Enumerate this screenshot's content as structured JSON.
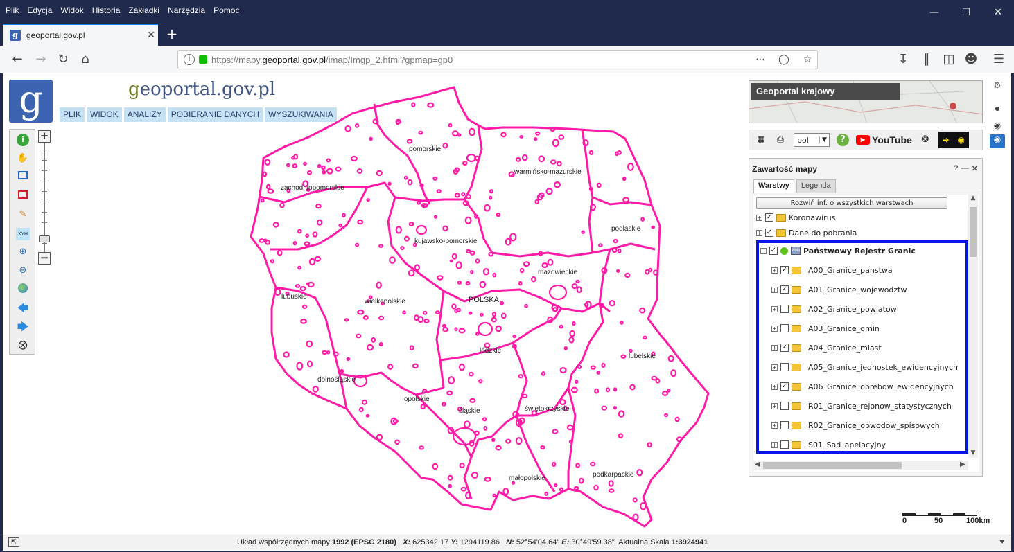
{
  "browser": {
    "menu": [
      "Plik",
      "Edycja",
      "Widok",
      "Historia",
      "Zakładki",
      "Narzędzia",
      "Pomoc"
    ],
    "tab_title": "geoportal.gov.pl",
    "url_prefix": "https://mapy.",
    "url_domain": "geoportal.gov.pl",
    "url_path": "/imap/Imgp_2.html?gpmap=gp0"
  },
  "site": {
    "logo_letter": "g",
    "title_g": "g",
    "title_rest": "eoportal.gov.pl",
    "menu": [
      "PLIK",
      "WIDOK",
      "ANALIZY",
      "POBIERANIE DANYCH",
      "WYSZUKIWANIA"
    ]
  },
  "map": {
    "country_label": "POLSKA",
    "border_color": "#ff1aa8",
    "voivodeships": [
      "pomorskie",
      "warmińsko-mazurskie",
      "zachodniopomorskie",
      "podlaskie",
      "kujawsko-pomorskie",
      "mazowieckie",
      "lubuskie",
      "wielkopolskie",
      "łódzkie",
      "lubelskie",
      "dolnośląskie",
      "opolskie",
      "śląskie",
      "świętokrzyskie",
      "małopolskie",
      "podkarpackie"
    ]
  },
  "right_panel": {
    "mini_map_title": "Geoportal krajowy",
    "language": "pol",
    "youtube_label": "YouTube",
    "panel_title": "Zawartość mapy",
    "tabs": [
      "Warstwy",
      "Legenda"
    ],
    "expand_button": "Rozwiń inf. o wszystkich warstwach",
    "top_layers": [
      {
        "name": "Koronawirus",
        "checked": true
      },
      {
        "name": "Dane do pobrania",
        "checked": true
      }
    ],
    "group": {
      "name": "Państwowy Rejestr Granic",
      "checked": true
    },
    "sub_layers": [
      {
        "name": "A00_Granice_panstwa",
        "checked": true
      },
      {
        "name": "A01_Granice_wojewodztw",
        "checked": true
      },
      {
        "name": "A02_Granice_powiatow",
        "checked": false
      },
      {
        "name": "A03_Granice_gmin",
        "checked": false
      },
      {
        "name": "A04_Granice_miast",
        "checked": true
      },
      {
        "name": "A05_Granice_jednostek_ewidencyjnych",
        "checked": false
      },
      {
        "name": "A06_Granice_obrebow_ewidencyjnych",
        "checked": true
      },
      {
        "name": "R01_Granice_rejonow_statystycznych",
        "checked": false
      },
      {
        "name": "R02_Granice_obwodow_spisowych",
        "checked": false
      },
      {
        "name": "S01_Sad_apelacyjny",
        "checked": false
      }
    ],
    "highlight_color": "#0016e8"
  },
  "scale": {
    "labels": [
      "0",
      "50",
      "100km"
    ]
  },
  "status": {
    "crs_label": "Układ współrzędnych mapy",
    "crs_value": "1992 (EPSG 2180)",
    "x_label": "X:",
    "x_value": "625342.17",
    "y_label": "Y:",
    "y_value": "1294119.86",
    "n_label": "N:",
    "n_value": "52°54'04.64\"",
    "e_label": "E:",
    "e_value": "30°49'59.38\"",
    "scale_label": "Aktualna Skala",
    "scale_value": "1:3924941"
  }
}
